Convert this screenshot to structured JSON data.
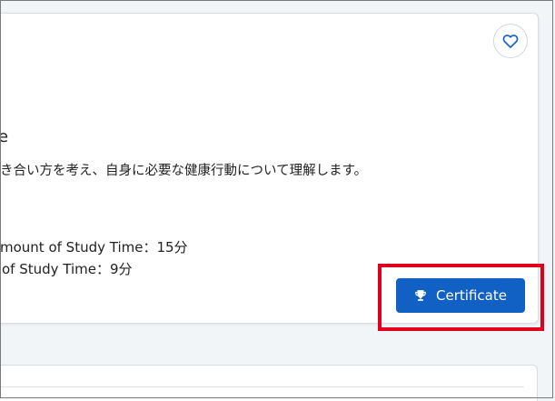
{
  "course_card": {
    "title_fragment": "e",
    "description": "き合い方を考え、自身に必要な健康行動について理解します。",
    "stat_total": "mount of Study Time：15分",
    "stat_done": "of Study Time：9分",
    "favorite_icon": "heart-outline-icon",
    "certificate_button": {
      "label": "Certificate",
      "icon": "trophy-icon",
      "color": "#1160c4"
    }
  },
  "highlight_color": "#e0001b"
}
